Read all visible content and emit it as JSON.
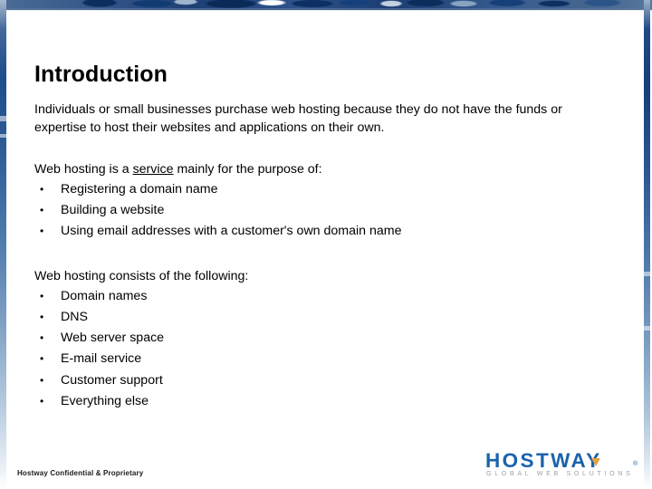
{
  "slide": {
    "title": "Introduction",
    "intro_paragraph": "Individuals or small businesses purchase web hosting because they do not have the funds or expertise to host their websites and applications on their own.",
    "service_section": {
      "lead_prefix": "Web hosting is a ",
      "lead_underlined": "service",
      "lead_suffix": " mainly for the purpose of:",
      "bullet_glyph": "•",
      "items": [
        "Registering a domain name",
        "Building a website",
        "Using email addresses with a customer's own domain name"
      ]
    },
    "consists_section": {
      "lead": "Web hosting consists of the following:",
      "bullet_glyph": "•",
      "items": [
        "Domain names",
        "DNS",
        "Web server space",
        "E-mail service",
        "Customer support",
        "Everything else"
      ]
    }
  },
  "footer": {
    "confidentiality_note": "Hostway Confidential & Proprietary",
    "logo": {
      "wordmark": "HOSTWAY",
      "registered_mark": "®",
      "tagline": "GLOBAL WEB SOLUTIONS",
      "wordmark_color": "#1a62ad",
      "accent_color": "#e8a33d",
      "tagline_color": "#9aa3ac"
    }
  },
  "decor": {
    "banner_color_dark": "#1d3f74",
    "banner_color_light": "#55779e",
    "edge_strip_color": "#1c4d8c"
  }
}
